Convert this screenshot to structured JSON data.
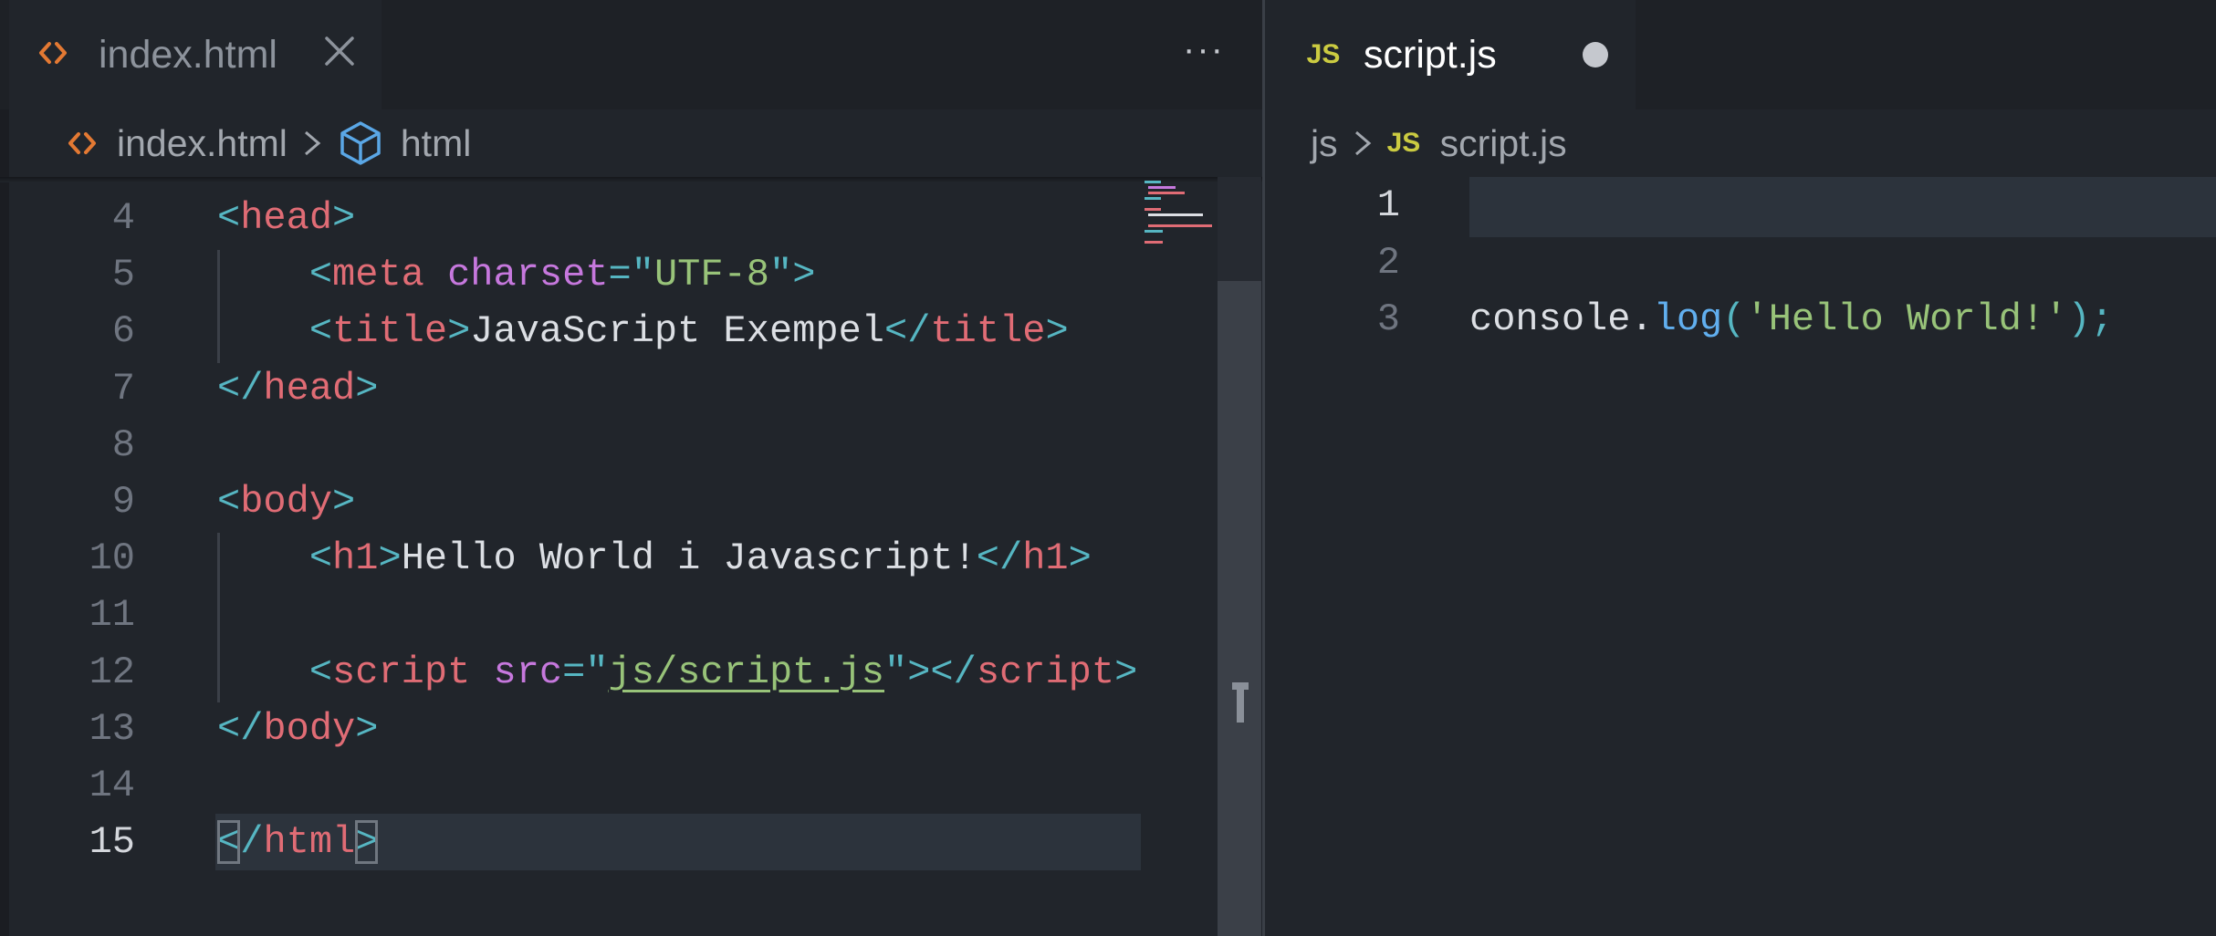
{
  "left_pane": {
    "tab": {
      "label": "index.html",
      "icon": "html-file-icon"
    },
    "more_actions": "···",
    "breadcrumb": {
      "file": "index.html",
      "symbol": "html"
    },
    "lines": [
      {
        "num": "4",
        "tokens": [
          {
            "c": "t",
            "v": "<"
          },
          {
            "c": "n",
            "v": "head"
          },
          {
            "c": "t",
            "v": ">"
          }
        ]
      },
      {
        "num": "5",
        "tokens": [
          {
            "c": "p",
            "v": "    "
          },
          {
            "c": "t",
            "v": "<"
          },
          {
            "c": "n",
            "v": "meta"
          },
          {
            "c": "p",
            "v": " "
          },
          {
            "c": "a",
            "v": "charset"
          },
          {
            "c": "t",
            "v": "=\""
          },
          {
            "c": "s",
            "v": "UTF-8"
          },
          {
            "c": "t",
            "v": "\">"
          }
        ]
      },
      {
        "num": "6",
        "tokens": [
          {
            "c": "p",
            "v": "    "
          },
          {
            "c": "t",
            "v": "<"
          },
          {
            "c": "n",
            "v": "title"
          },
          {
            "c": "t",
            "v": ">"
          },
          {
            "c": "p",
            "v": "JavaScript Exempel"
          },
          {
            "c": "t",
            "v": "</"
          },
          {
            "c": "n",
            "v": "title"
          },
          {
            "c": "t",
            "v": ">"
          }
        ]
      },
      {
        "num": "7",
        "tokens": [
          {
            "c": "t",
            "v": "</"
          },
          {
            "c": "n",
            "v": "head"
          },
          {
            "c": "t",
            "v": ">"
          }
        ]
      },
      {
        "num": "8",
        "tokens": []
      },
      {
        "num": "9",
        "tokens": [
          {
            "c": "t",
            "v": "<"
          },
          {
            "c": "n",
            "v": "body"
          },
          {
            "c": "t",
            "v": ">"
          }
        ]
      },
      {
        "num": "10",
        "tokens": [
          {
            "c": "p",
            "v": "    "
          },
          {
            "c": "t",
            "v": "<"
          },
          {
            "c": "n",
            "v": "h1"
          },
          {
            "c": "t",
            "v": ">"
          },
          {
            "c": "p",
            "v": "Hello World i Javascript!"
          },
          {
            "c": "t",
            "v": "</"
          },
          {
            "c": "n",
            "v": "h1"
          },
          {
            "c": "t",
            "v": ">"
          }
        ]
      },
      {
        "num": "11",
        "tokens": []
      },
      {
        "num": "12",
        "tokens": [
          {
            "c": "p",
            "v": "    "
          },
          {
            "c": "t",
            "v": "<"
          },
          {
            "c": "n",
            "v": "script"
          },
          {
            "c": "p",
            "v": " "
          },
          {
            "c": "a",
            "v": "src"
          },
          {
            "c": "t",
            "v": "=\""
          },
          {
            "c": "s ul",
            "v": "js/script.js"
          },
          {
            "c": "t",
            "v": "\"></"
          },
          {
            "c": "n",
            "v": "script"
          },
          {
            "c": "t",
            "v": ">"
          }
        ]
      },
      {
        "num": "13",
        "tokens": [
          {
            "c": "t",
            "v": "</"
          },
          {
            "c": "n",
            "v": "body"
          },
          {
            "c": "t",
            "v": ">"
          }
        ]
      },
      {
        "num": "14",
        "tokens": []
      },
      {
        "num": "15",
        "active": true,
        "tokens": [
          {
            "c": "t bm",
            "v": "<"
          },
          {
            "c": "t",
            "v": "/"
          },
          {
            "c": "n",
            "v": "html"
          },
          {
            "c": "t bm",
            "v": ">"
          }
        ]
      }
    ]
  },
  "right_pane": {
    "tab": {
      "label": "script.js",
      "icon": "js-file-icon",
      "unsaved": true
    },
    "breadcrumb": {
      "folder": "js",
      "file": "script.js"
    },
    "lines": [
      {
        "num": "1",
        "active": true,
        "tokens": []
      },
      {
        "num": "2",
        "tokens": []
      },
      {
        "num": "3",
        "tokens": [
          {
            "c": "p",
            "v": "console."
          },
          {
            "c": "f",
            "v": "log"
          },
          {
            "c": "t",
            "v": "("
          },
          {
            "c": "s",
            "v": "'Hello World!'"
          },
          {
            "c": "t",
            "v": ");"
          }
        ]
      }
    ]
  },
  "colors": {
    "editor_bg": "#21252b",
    "tag": "#56b6c2",
    "tag_name": "#e06c75",
    "attribute": "#c678dd",
    "string": "#98c379",
    "function": "#61afef",
    "html_icon": "#e37933",
    "js_icon": "#cbcb41"
  }
}
